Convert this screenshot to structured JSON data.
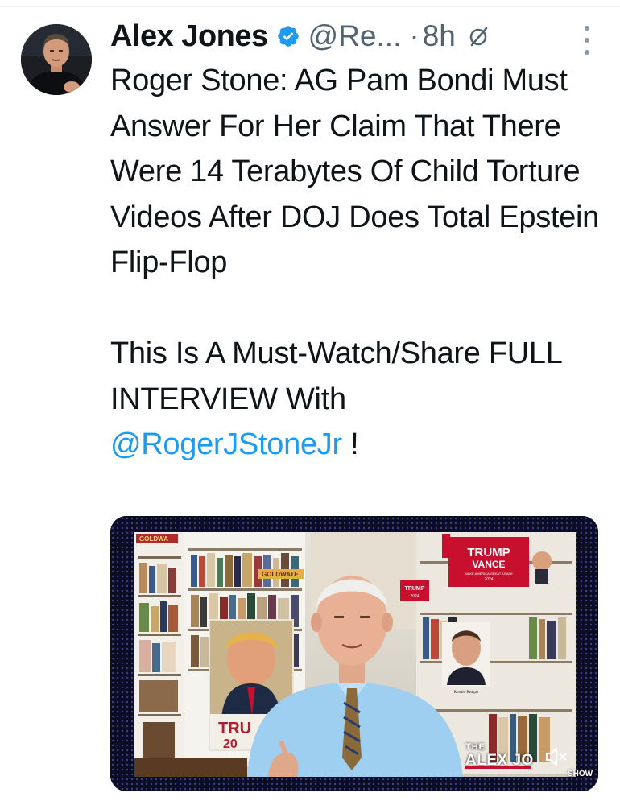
{
  "tweet": {
    "author": {
      "name": "Alex Jones",
      "handle": "@Re...",
      "time_separator": "·",
      "time": "8h"
    },
    "text": {
      "line1": "Roger Stone: AG Pam Bondi Must Answer For Her Claim That There Were 14 Terabytes Of Child Torture Videos After DOJ Does Total Epstein Flip-Flop",
      "line2": "This Is A Must-Watch/Share FULL INTERVIEW With",
      "mention": "@RogerJStoneJr",
      "trailing": " !"
    },
    "media": {
      "type": "video",
      "overlay": {
        "brand_small": "THE",
        "brand_big": "ALEX JO",
        "brand_show": "SHOW"
      },
      "poster_texts": {
        "goldwater_sign_1": "GOLDWA",
        "goldwater_sign_2": "GOLDWATE",
        "trump_vance_line1": "TRUMP",
        "trump_vance_line2": "VANCE",
        "trump_vance_line3": "MAKE AMERICA GREAT AGAIN!",
        "trump_vance_line4": "2024",
        "trump_small": "TRUMP",
        "trump_small_year": "2024",
        "trump_poster_1": "TRU",
        "trump_poster_2": "20",
        "reagan_caption": "Ronald Reagan"
      }
    },
    "icons": {
      "verified": "verified-badge-icon",
      "grok": "grok-icon",
      "more": "more-vertical-icon",
      "mute": "speaker-muted-icon"
    }
  },
  "colors": {
    "text_primary": "#0f1419",
    "text_secondary": "#536471",
    "accent_blue": "#1d9bf0",
    "trump_sign_red": "#c8102e"
  }
}
